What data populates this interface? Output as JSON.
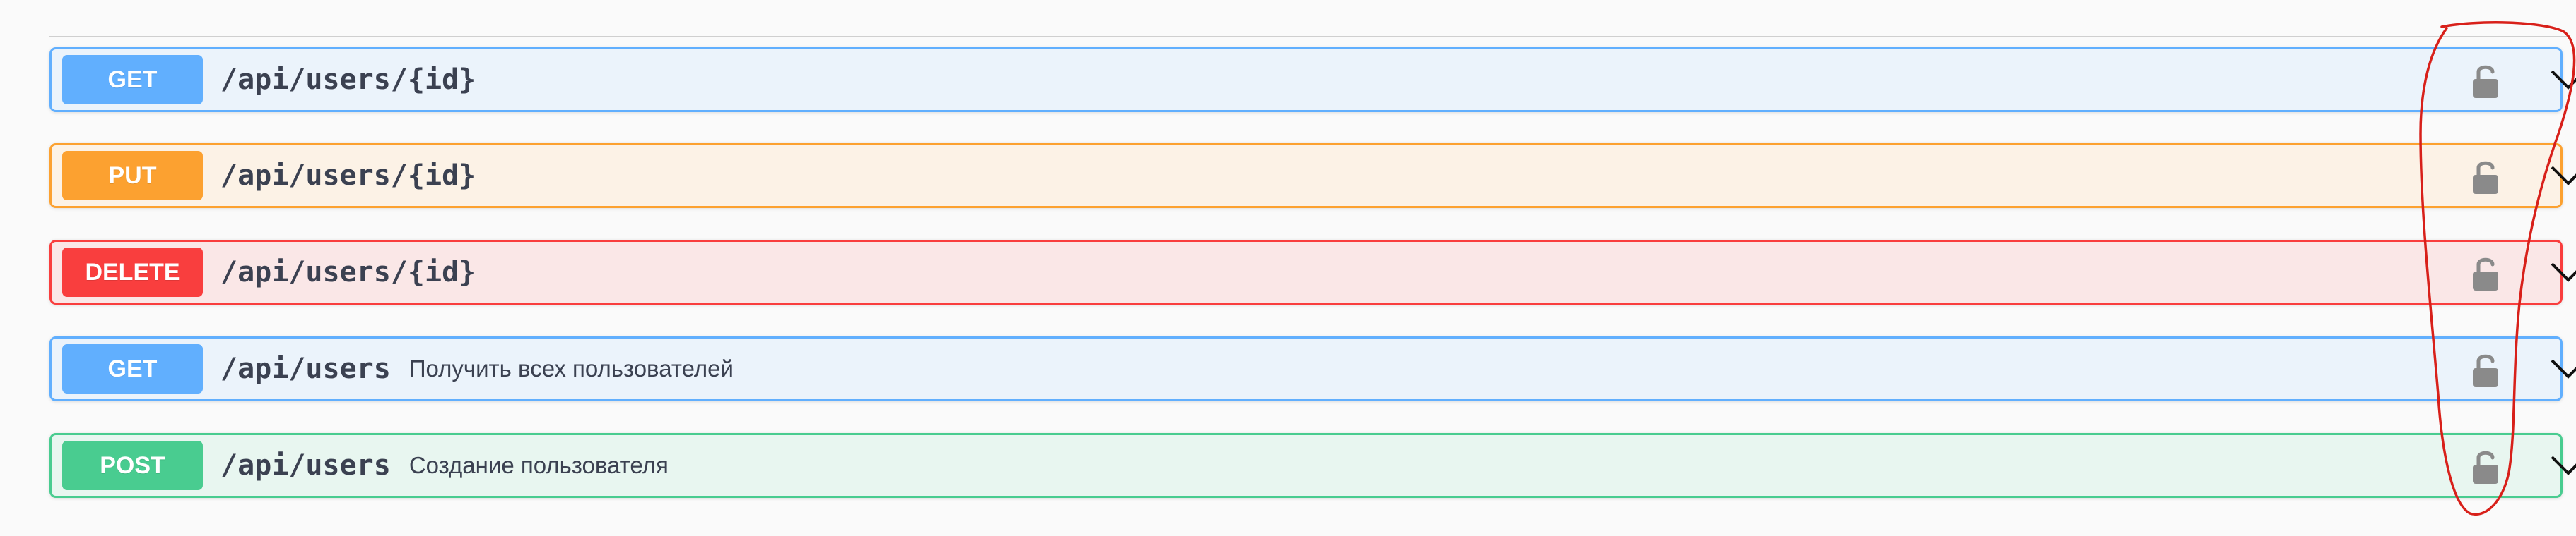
{
  "operations": [
    {
      "method": "GET",
      "path": "/api/users/{id}",
      "summary": "",
      "lock_icon": "unlocked-padlock-icon",
      "expand_icon": "chevron-down-icon"
    },
    {
      "method": "PUT",
      "path": "/api/users/{id}",
      "summary": "",
      "lock_icon": "unlocked-padlock-icon",
      "expand_icon": "chevron-down-icon"
    },
    {
      "method": "DELETE",
      "path": "/api/users/{id}",
      "summary": "",
      "lock_icon": "unlocked-padlock-icon",
      "expand_icon": "chevron-down-icon"
    },
    {
      "method": "GET",
      "path": "/api/users",
      "summary": "Получить всех пользователей",
      "lock_icon": "unlocked-padlock-icon",
      "expand_icon": "chevron-down-icon"
    },
    {
      "method": "POST",
      "path": "/api/users",
      "summary": "Создание пользователя",
      "lock_icon": "unlocked-padlock-icon",
      "expand_icon": "chevron-down-icon"
    }
  ],
  "colors": {
    "get": "#61affe",
    "put": "#fca130",
    "delete": "#f93e3e",
    "post": "#49cc90",
    "text": "#3b4151",
    "annotation": "#d8201a"
  }
}
